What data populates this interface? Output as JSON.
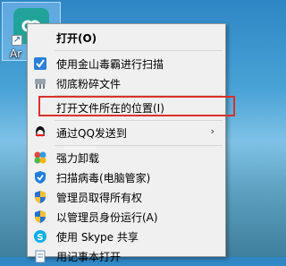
{
  "desktop": {
    "icon_label": "Ar"
  },
  "menu": {
    "items": [
      {
        "label": "打开(O)",
        "icon": "none",
        "bold": true
      },
      {
        "label": "使用金山毒霸进行扫描",
        "icon": "duba-icon"
      },
      {
        "label": "彻底粉碎文件",
        "icon": "shredder-icon"
      },
      {
        "label": "打开文件所在的位置(I)",
        "icon": "none"
      },
      {
        "label": "通过QQ发送到",
        "icon": "qq-icon",
        "submenu": true
      },
      {
        "label": "强力卸载",
        "icon": "uninstall-icon"
      },
      {
        "label": "扫描病毒(电脑管家)",
        "icon": "pc-manager-icon"
      },
      {
        "label": "管理员取得所有权",
        "icon": "uac-shield-icon"
      },
      {
        "label": "以管理员身份运行(A)",
        "icon": "uac-shield-icon"
      },
      {
        "label": "使用 Skype 共享",
        "icon": "skype-icon"
      },
      {
        "label": "用记事本打开",
        "icon": "notepad-icon"
      }
    ],
    "submenu_arrow": "›"
  },
  "colors": {
    "highlight": "#d9312b",
    "menu_bg": "#f0f0f0"
  }
}
